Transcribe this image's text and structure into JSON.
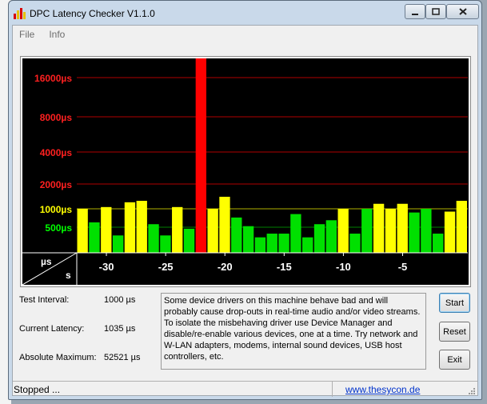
{
  "window": {
    "title": "DPC Latency Checker V1.1.0"
  },
  "menu": [
    "File",
    "Info"
  ],
  "graph": {
    "y_labels": [
      "16000µs",
      "8000µs",
      "4000µs",
      "2000µs",
      "1000µs",
      "500µs"
    ],
    "y_label_colors": [
      "#ff2020",
      "#ff2020",
      "#ff2020",
      "#ff2020",
      "#ffff00",
      "#00ff00"
    ],
    "x_ticks": [
      "-30",
      "-25",
      "-20",
      "-15",
      "-10",
      "-5"
    ],
    "unit_us": "µs",
    "unit_s": "s",
    "bars": [
      {
        "level": 1000,
        "color": "yellow"
      },
      {
        "level": 600,
        "color": "green"
      },
      {
        "level": 1050,
        "color": "yellow"
      },
      {
        "level": 400,
        "color": "green"
      },
      {
        "level": 1200,
        "color": "yellow"
      },
      {
        "level": 1250,
        "color": "yellow"
      },
      {
        "level": 560,
        "color": "green"
      },
      {
        "level": 400,
        "color": "green"
      },
      {
        "level": 1050,
        "color": "yellow"
      },
      {
        "level": 480,
        "color": "green"
      },
      {
        "level": 52521,
        "color": "red"
      },
      {
        "level": 1000,
        "color": "yellow"
      },
      {
        "level": 1400,
        "color": "yellow"
      },
      {
        "level": 720,
        "color": "green"
      },
      {
        "level": 520,
        "color": "green"
      },
      {
        "level": 380,
        "color": "green"
      },
      {
        "level": 420,
        "color": "green"
      },
      {
        "level": 420,
        "color": "green"
      },
      {
        "level": 820,
        "color": "green"
      },
      {
        "level": 380,
        "color": "green"
      },
      {
        "level": 560,
        "color": "green"
      },
      {
        "level": 650,
        "color": "green"
      },
      {
        "level": 1000,
        "color": "yellow"
      },
      {
        "level": 420,
        "color": "green"
      },
      {
        "level": 1000,
        "color": "green"
      },
      {
        "level": 1150,
        "color": "yellow"
      },
      {
        "level": 1000,
        "color": "yellow"
      },
      {
        "level": 1150,
        "color": "yellow"
      },
      {
        "level": 870,
        "color": "green"
      },
      {
        "level": 1000,
        "color": "green"
      },
      {
        "level": 420,
        "color": "green"
      },
      {
        "level": 900,
        "color": "yellow"
      },
      {
        "level": 1250,
        "color": "yellow"
      }
    ]
  },
  "stats": {
    "test_interval_label": "Test Interval:",
    "test_interval_value": "1000 µs",
    "current_latency_label": "Current Latency:",
    "current_latency_value": "1035 µs",
    "absolute_max_label": "Absolute Maximum:",
    "absolute_max_value": "52521 µs"
  },
  "message": "Some device drivers on this machine behave bad and will probably cause drop-outs in real-time audio and/or video streams. To isolate the misbehaving driver use Device Manager and disable/re-enable various devices, one at a time. Try network and W-LAN adapters, modems, internal sound devices, USB host controllers, etc.",
  "buttons": {
    "start": "Start",
    "reset": "Reset",
    "exit": "Exit"
  },
  "status": {
    "text": "Stopped ...",
    "link": "www.thesycon.de"
  },
  "colors": {
    "red": "#ff0000",
    "yellow": "#ffff00",
    "green": "#00e000",
    "gridline": "#b00000"
  }
}
